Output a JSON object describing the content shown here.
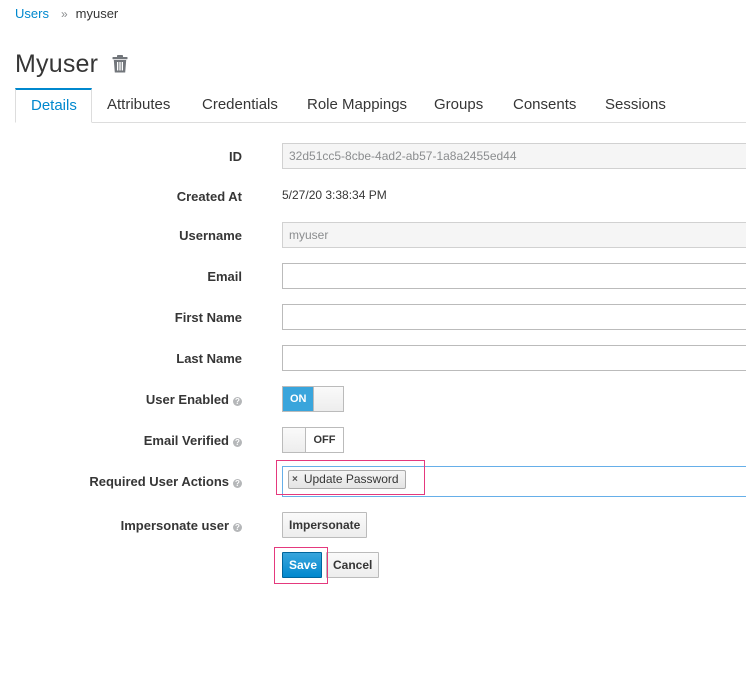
{
  "breadcrumb": {
    "parent": "Users",
    "separator": "»",
    "current": "myuser"
  },
  "page": {
    "title": "Myuser"
  },
  "tabs": [
    {
      "label": "Details",
      "active": true
    },
    {
      "label": "Attributes"
    },
    {
      "label": "Credentials"
    },
    {
      "label": "Role Mappings"
    },
    {
      "label": "Groups"
    },
    {
      "label": "Consents"
    },
    {
      "label": "Sessions"
    }
  ],
  "form": {
    "id": {
      "label": "ID",
      "value": "32d51cc5-8cbe-4ad2-ab57-1a8a2455ed44"
    },
    "created_at": {
      "label": "Created At",
      "value": "5/27/20 3:38:34 PM"
    },
    "username": {
      "label": "Username",
      "value": "myuser"
    },
    "email": {
      "label": "Email",
      "value": ""
    },
    "first_name": {
      "label": "First Name",
      "value": ""
    },
    "last_name": {
      "label": "Last Name",
      "value": ""
    },
    "user_enabled": {
      "label": "User Enabled",
      "state": "ON"
    },
    "email_verified": {
      "label": "Email Verified",
      "state": "OFF"
    },
    "required_actions": {
      "label": "Required User Actions",
      "selected": [
        "Update Password"
      ],
      "remove_glyph": "×"
    },
    "impersonate": {
      "label": "Impersonate user",
      "button": "Impersonate"
    }
  },
  "help_glyph": "?",
  "actions": {
    "save": "Save",
    "cancel": "Cancel"
  },
  "colors": {
    "accent": "#0088ce",
    "switch_on": "#39a5dc",
    "highlight": "#e4397d"
  }
}
